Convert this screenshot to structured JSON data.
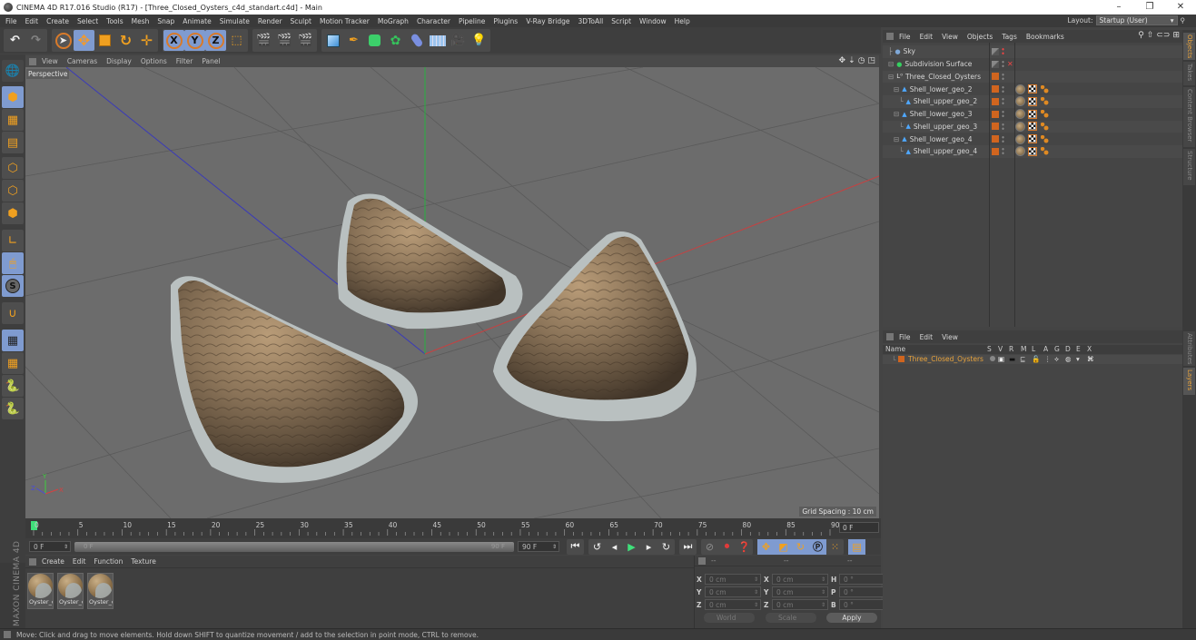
{
  "window": {
    "title": "CINEMA 4D R17.016 Studio (R17) - [Three_Closed_Oysters_c4d_standart.c4d] - Main",
    "controls": [
      "–",
      "❐",
      "✕"
    ]
  },
  "menubar": {
    "items": [
      "File",
      "Edit",
      "Create",
      "Select",
      "Tools",
      "Mesh",
      "Snap",
      "Animate",
      "Simulate",
      "Render",
      "Sculpt",
      "Motion Tracker",
      "MoGraph",
      "Character",
      "Pipeline",
      "Plugins",
      "V-Ray Bridge",
      "3DToAll",
      "Script",
      "Window",
      "Help"
    ],
    "layout_label": "Layout:",
    "layout_value": "Startup (User)"
  },
  "toolbar": {
    "axis_x": "X",
    "axis_y": "Y",
    "axis_z": "Z"
  },
  "viewport": {
    "menu": [
      "View",
      "Cameras",
      "Display",
      "Options",
      "Filter",
      "Panel"
    ],
    "camera_label": "Perspective",
    "grid_spacing": "Grid Spacing : 10 cm",
    "axis_labels": {
      "x": "X",
      "y": "Y",
      "z": "Z"
    }
  },
  "timeline": {
    "ticks": [
      "0",
      "5",
      "10",
      "15",
      "20",
      "25",
      "30",
      "35",
      "40",
      "45",
      "50",
      "55",
      "60",
      "65",
      "70",
      "75",
      "80",
      "85",
      "90"
    ],
    "current_frame_right": "0 F",
    "start_field": "0 F",
    "range_start": "0 F",
    "range_end": "90 F",
    "end_field": "90 F"
  },
  "material_manager": {
    "menu": [
      "Create",
      "Edit",
      "Function",
      "Texture"
    ],
    "materials": [
      {
        "label": "Oyster_c"
      },
      {
        "label": "Oyster_c"
      },
      {
        "label": "Oyster_c"
      }
    ]
  },
  "brand": "MAXON CINEMA 4D",
  "coordinates": {
    "headers": [
      "--",
      "--",
      "--"
    ],
    "rows": [
      {
        "a": "X",
        "av": "0 cm",
        "b": "X",
        "bv": "0 cm",
        "c": "H",
        "cv": "0 °"
      },
      {
        "a": "Y",
        "av": "0 cm",
        "b": "Y",
        "bv": "0 cm",
        "c": "P",
        "cv": "0 °"
      },
      {
        "a": "Z",
        "av": "0 cm",
        "b": "Z",
        "bv": "0 cm",
        "c": "B",
        "cv": "0 °"
      }
    ],
    "mode_select": "World",
    "transform_select": "Scale",
    "apply_label": "Apply"
  },
  "status": "Move: Click and drag to move elements. Hold down SHIFT to quantize movement / add to the selection in point mode, CTRL to remove.",
  "object_manager": {
    "menu": [
      "File",
      "Edit",
      "View",
      "Objects",
      "Tags",
      "Bookmarks"
    ],
    "objects": [
      {
        "name": "Sky",
        "indent": 0,
        "icon": "sky",
        "tags": false,
        "vis": "grey",
        "xmark": false
      },
      {
        "name": "Subdivision Surface",
        "indent": 0,
        "icon": "subdivision",
        "tags": false,
        "vis": "grey",
        "xmark": true
      },
      {
        "name": "Three_Closed_Oysters",
        "indent": 1,
        "icon": "null",
        "tags": false,
        "vis": "orange",
        "xmark": false
      },
      {
        "name": "Shell_lower_geo_2",
        "indent": 2,
        "icon": "polygon",
        "tags": true,
        "vis": "orange",
        "xmark": false
      },
      {
        "name": "Shell_upper_geo_2",
        "indent": 3,
        "icon": "polygon",
        "tags": true,
        "vis": "orange",
        "xmark": false
      },
      {
        "name": "Shell_lower_geo_3",
        "indent": 2,
        "icon": "polygon",
        "tags": true,
        "vis": "orange",
        "xmark": false
      },
      {
        "name": "Shell_upper_geo_3",
        "indent": 3,
        "icon": "polygon",
        "tags": true,
        "vis": "orange",
        "xmark": false
      },
      {
        "name": "Shell_lower_geo_4",
        "indent": 2,
        "icon": "polygon",
        "tags": true,
        "vis": "orange",
        "xmark": false
      },
      {
        "name": "Shell_upper_geo_4",
        "indent": 3,
        "icon": "polygon",
        "tags": true,
        "vis": "orange",
        "xmark": false
      }
    ]
  },
  "layer_manager": {
    "menu": [
      "File",
      "Edit",
      "View"
    ],
    "columns": [
      "Name",
      "S",
      "V",
      "R",
      "M",
      "L",
      "A",
      "G",
      "D",
      "E",
      "X"
    ],
    "layers": [
      {
        "name": "Three_Closed_Oysters",
        "color": "#d0651f"
      }
    ]
  },
  "right_tabs": {
    "top": [
      "Objects",
      "Takes",
      "Content Browser",
      "Structure"
    ],
    "bottom": [
      "Attributes",
      "Layers"
    ]
  },
  "colors": {
    "accent_orange": "#d0651f",
    "active_blue": "#7f9bd0",
    "playhead_green": "#3fe07a",
    "tab_active": "#e7a23c"
  }
}
